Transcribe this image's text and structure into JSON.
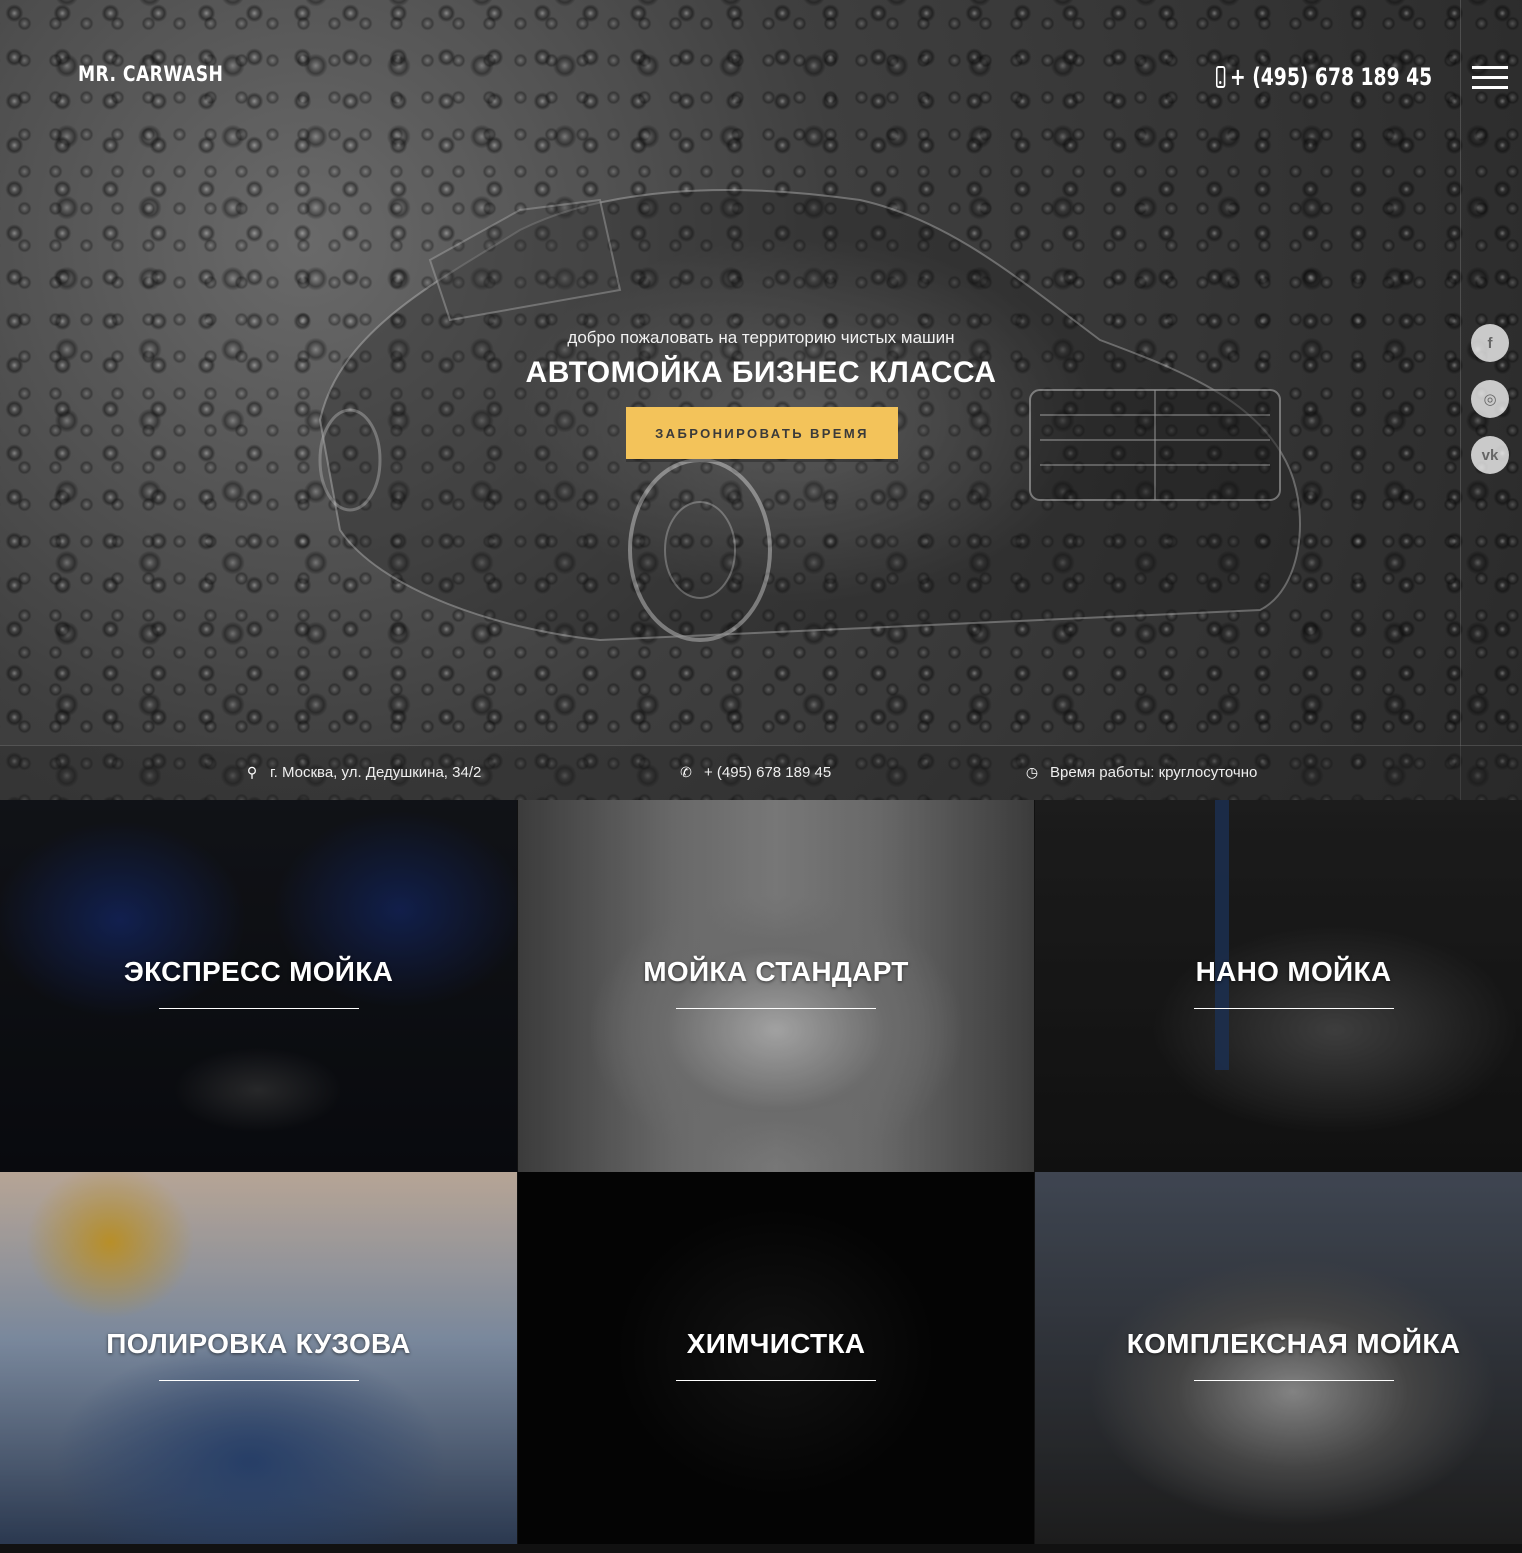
{
  "header": {
    "logo": "MR. CARWASH",
    "phone": "+ (495) 678 189 45"
  },
  "hero": {
    "subtitle": "добро пожаловать на территорию чистых машин",
    "title": "АВТОМОЙКА БИЗНЕС КЛАССА",
    "cta_label": "ЗАБРОНИРОВАТЬ ВРЕМЯ"
  },
  "socials": [
    {
      "label": "f",
      "icon": "facebook-icon"
    },
    {
      "label": "◎",
      "icon": "instagram-icon"
    },
    {
      "label": "vk",
      "icon": "vk-icon"
    }
  ],
  "info": {
    "address": "г. Москва, ул. Дедушкина, 34/2",
    "phone": "+ (495) 678 189 45",
    "hours": "Время работы: круглосуточно"
  },
  "services": [
    {
      "title": "ЭКСПРЕСС МОЙКА"
    },
    {
      "title": "МОЙКА СТАНДАРТ"
    },
    {
      "title": "НАНО МОЙКА"
    },
    {
      "title": "ПОЛИРОВКА КУЗОВА"
    },
    {
      "title": "ХИМЧИСТКА"
    },
    {
      "title": "КОМПЛЕКСНАЯ МОЙКА"
    }
  ],
  "colors": {
    "accent": "#f3c35a"
  }
}
